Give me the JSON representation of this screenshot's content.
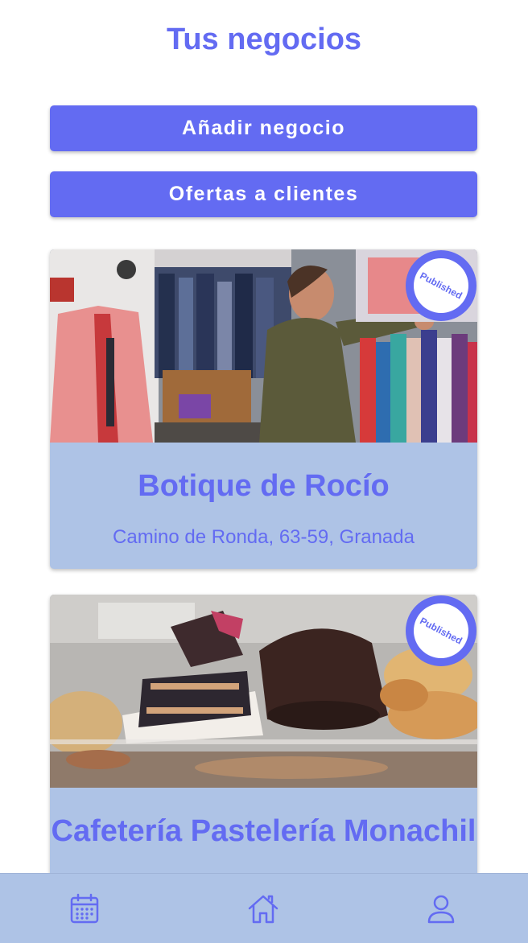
{
  "header": {
    "title": "Tus negocios"
  },
  "actions": {
    "add_business": "Añadir negocio",
    "customer_offers": "Ofertas a clientes"
  },
  "businesses": [
    {
      "name": "Botique de Rocío",
      "address": "Camino de Ronda, 63-59, Granada",
      "status": "Published",
      "photo": "clothing-store-photo"
    },
    {
      "name": "Cafetería Pastelería Monachil",
      "address": "",
      "status": "Published",
      "photo": "pastry-display-photo"
    }
  ],
  "bottom_nav": {
    "items": [
      {
        "icon": "calendar-icon"
      },
      {
        "icon": "home-icon"
      },
      {
        "icon": "user-icon"
      }
    ]
  },
  "colors": {
    "accent": "#636bf2",
    "card_background": "#aec3e6",
    "nav_background": "#aec3e6"
  }
}
